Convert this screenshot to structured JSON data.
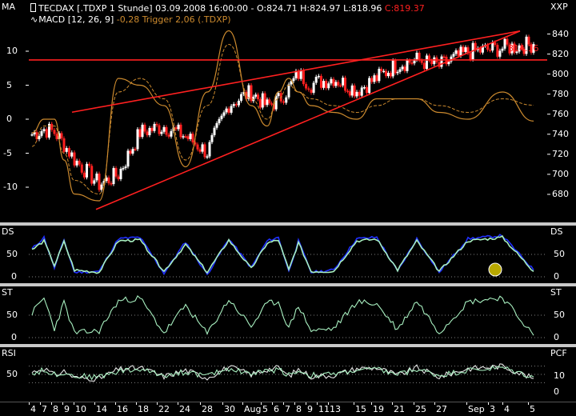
{
  "colors": {
    "background": "#000000",
    "macd": "#cc8a2e",
    "trigger": "#cc8a2e",
    "trendline": "#ff2020",
    "candle_up": "#ffffff",
    "candle_down": "#ff2020",
    "stoch_main": "#2030ff",
    "stoch_signal": "#a8f0c0",
    "rsi": "#e6e6e6",
    "grid": "#808080"
  },
  "main_pane": {
    "left_label": "MA",
    "right_label": "XXP",
    "header_line1_prefix": "TECDAX [.TDXP  1 Stunde] 03.09.2008 16:00:00 - O:824.71 H:824.97 L:818.96 ",
    "header_line1_close": "C:819.37",
    "header_line2_prefix": "MACD [12, 26, 9] ",
    "header_line2_values": "-0,28 Trigger 2,06 (.TDXP)",
    "price_label": "814.16",
    "left_ticks": [
      "10",
      "5",
      "0",
      "-5",
      "-10"
    ],
    "right_ticks": [
      "840",
      "820",
      "800",
      "780",
      "760",
      "740",
      "720",
      "700",
      "680"
    ]
  },
  "panes": [
    {
      "left_label": "DS",
      "right_label": "DS",
      "left_ticks": [
        "50",
        "0"
      ],
      "right_ticks": [
        "50",
        "0"
      ]
    },
    {
      "left_label": "ST",
      "right_label": "ST",
      "left_ticks": [
        "50",
        "0"
      ],
      "right_ticks": [
        "50",
        "0"
      ]
    },
    {
      "left_label": "RSI",
      "right_label": "PCF",
      "left_ticks": [
        "50"
      ],
      "right_ticks": [
        "10",
        "0"
      ]
    }
  ],
  "x_axis": {
    "ticks": [
      "4",
      "7",
      "8",
      "9",
      "10",
      "14",
      "16",
      "18",
      "22",
      "24",
      "28",
      "30",
      "Aug",
      "5",
      "6",
      "7",
      "8",
      "9",
      "11",
      "13",
      "15",
      "19",
      "21",
      "25",
      "27",
      "Sep",
      "3",
      "4",
      "5"
    ]
  },
  "chart_data": [
    {
      "type": "line",
      "title": "TECDAX [.TDXP  1 Stunde] 03.09.2008 16:00:00 - O:824.71 H:824.97 L:818.96 C:819.37",
      "x": [
        "4",
        "7",
        "8",
        "9",
        "10",
        "14",
        "16",
        "18",
        "22",
        "24",
        "28",
        "30",
        "Aug",
        "5",
        "6",
        "7",
        "8",
        "9",
        "11",
        "13",
        "15",
        "19",
        "21",
        "25",
        "27",
        "Sep",
        "3"
      ],
      "series": [
        {
          "name": "TECDAX",
          "values": [
            740,
            745,
            742,
            730,
            715,
            690,
            700,
            742,
            748,
            738,
            722,
            770,
            782,
            768,
            774,
            786,
            800,
            790,
            796,
            784,
            796,
            810,
            814,
            808,
            822,
            826,
            830
          ]
        },
        {
          "name": "MACD [12, 26, 9]",
          "values": [
            -2,
            0,
            0,
            -6,
            -11,
            -12,
            6,
            5,
            2,
            -7,
            4,
            13,
            2,
            -1,
            4,
            6,
            4,
            2,
            1,
            0,
            3,
            3,
            3,
            1,
            0,
            4,
            -0.28
          ]
        },
        {
          "name": "Trigger",
          "values": [
            -4,
            -1,
            -1,
            -5,
            -9,
            -11,
            4,
            6,
            3,
            -6,
            2,
            11,
            3,
            0,
            3,
            5,
            4,
            3,
            2,
            1,
            2,
            3,
            3,
            2,
            1,
            3,
            2.06
          ]
        }
      ],
      "trendlines": [
        {
          "from": [
            "14",
            665
          ],
          "to": [
            "4",
            843
          ]
        },
        {
          "from": [
            "4",
            762
          ],
          "to": [
            "4",
            843
          ]
        },
        {
          "from": [
            "4",
            814.16
          ],
          "to": [
            "5",
            814.16
          ]
        }
      ],
      "ylim_left": [
        -14,
        14
      ],
      "ylim_right": [
        660,
        850
      ]
    },
    {
      "type": "line",
      "x": [
        "4",
        "7",
        "8",
        "9",
        "10",
        "14",
        "16",
        "18",
        "22",
        "24",
        "28",
        "30",
        "Aug",
        "5",
        "6",
        "7",
        "8",
        "9",
        "11",
        "13",
        "15",
        "19",
        "21",
        "25",
        "27",
        "Sep",
        "3"
      ],
      "series": [
        {
          "values": [
            62,
            88,
            20,
            82,
            10,
            12,
            85,
            88,
            8,
            78,
            5,
            85,
            20,
            80,
            88,
            12,
            80,
            10,
            15,
            85,
            88,
            12,
            85,
            10,
            85,
            92,
            15
          ]
        },
        {
          "values": [
            60,
            80,
            25,
            78,
            15,
            10,
            80,
            82,
            12,
            72,
            10,
            82,
            18,
            75,
            82,
            15,
            76,
            12,
            12,
            80,
            84,
            15,
            80,
            12,
            80,
            88,
            12
          ]
        }
      ],
      "ylim": [
        0,
        100
      ]
    },
    {
      "type": "line",
      "x": [
        "4",
        "7",
        "8",
        "9",
        "10",
        "14",
        "16",
        "18",
        "22",
        "24",
        "28",
        "30",
        "Aug",
        "5",
        "6",
        "7",
        "8",
        "9",
        "11",
        "13",
        "15",
        "19",
        "21",
        "25",
        "27",
        "Sep",
        "3"
      ],
      "series": [
        {
          "values": [
            55,
            88,
            20,
            78,
            10,
            15,
            82,
            88,
            10,
            72,
            8,
            85,
            25,
            76,
            80,
            20,
            72,
            15,
            20,
            80,
            75,
            18,
            82,
            12,
            80,
            90,
            5
          ]
        }
      ],
      "ylim": [
        0,
        100
      ]
    },
    {
      "type": "line",
      "x": [
        "4",
        "7",
        "8",
        "9",
        "10",
        "14",
        "16",
        "18",
        "22",
        "24",
        "28",
        "30",
        "Aug",
        "5",
        "6",
        "7",
        "8",
        "9",
        "11",
        "13",
        "15",
        "19",
        "21",
        "25",
        "27",
        "Sep",
        "3"
      ],
      "series": [
        {
          "values": [
            55,
            65,
            48,
            58,
            42,
            40,
            62,
            66,
            45,
            60,
            42,
            68,
            50,
            62,
            66,
            46,
            62,
            45,
            48,
            64,
            66,
            48,
            66,
            44,
            64,
            70,
            40
          ]
        },
        {
          "values": [
            52,
            60,
            50,
            55,
            46,
            44,
            58,
            62,
            48,
            56,
            46,
            64,
            52,
            58,
            62,
            50,
            58,
            48,
            50,
            60,
            62,
            50,
            62,
            48,
            60,
            66,
            44
          ]
        }
      ],
      "ylim": [
        0,
        100
      ]
    }
  ]
}
